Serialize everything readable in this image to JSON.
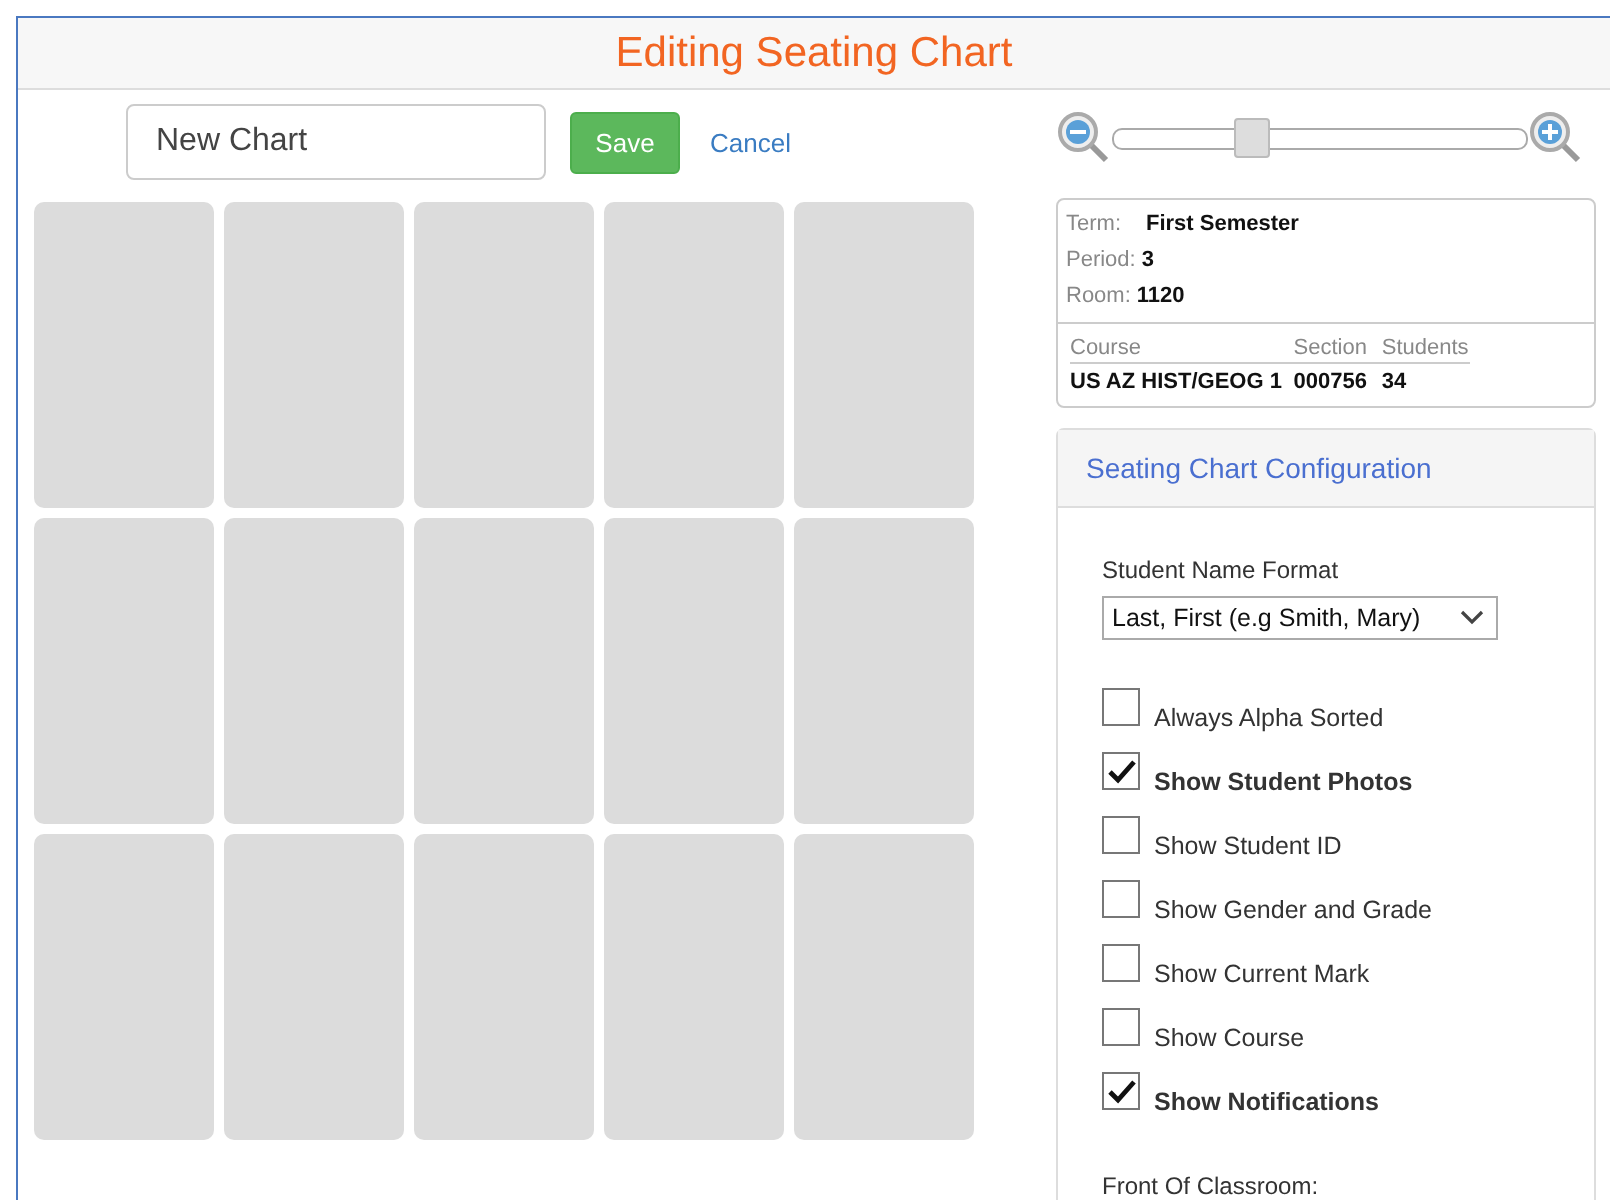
{
  "title": "Editing Seating Chart",
  "chart_name": {
    "value": "New Chart"
  },
  "save_button": "Save",
  "cancel_link": "Cancel",
  "zoom": {
    "level": 0.33
  },
  "info": {
    "term_label": "Term:",
    "term": "First Semester",
    "period_label": "Period:",
    "period": "3",
    "room_label": "Room:",
    "room": "1120",
    "columns": [
      "Course",
      "Section",
      "Students"
    ],
    "row": [
      "US AZ HIST/GEOG 1",
      "000756",
      "34"
    ]
  },
  "config": {
    "title": "Seating Chart Configuration",
    "name_format_label": "Student Name Format",
    "name_format": "Last, First (e.g Smith, Mary)",
    "options": [
      {
        "label": "Always Alpha Sorted",
        "checked": false
      },
      {
        "label": "Show Student Photos",
        "checked": true
      },
      {
        "label": "Show Student ID",
        "checked": false
      },
      {
        "label": "Show Gender and Grade",
        "checked": false
      },
      {
        "label": "Show Current Mark",
        "checked": false
      },
      {
        "label": "Show Course",
        "checked": false
      },
      {
        "label": "Show Notifications",
        "checked": true
      }
    ],
    "front_label": "Front Of Classroom:"
  }
}
